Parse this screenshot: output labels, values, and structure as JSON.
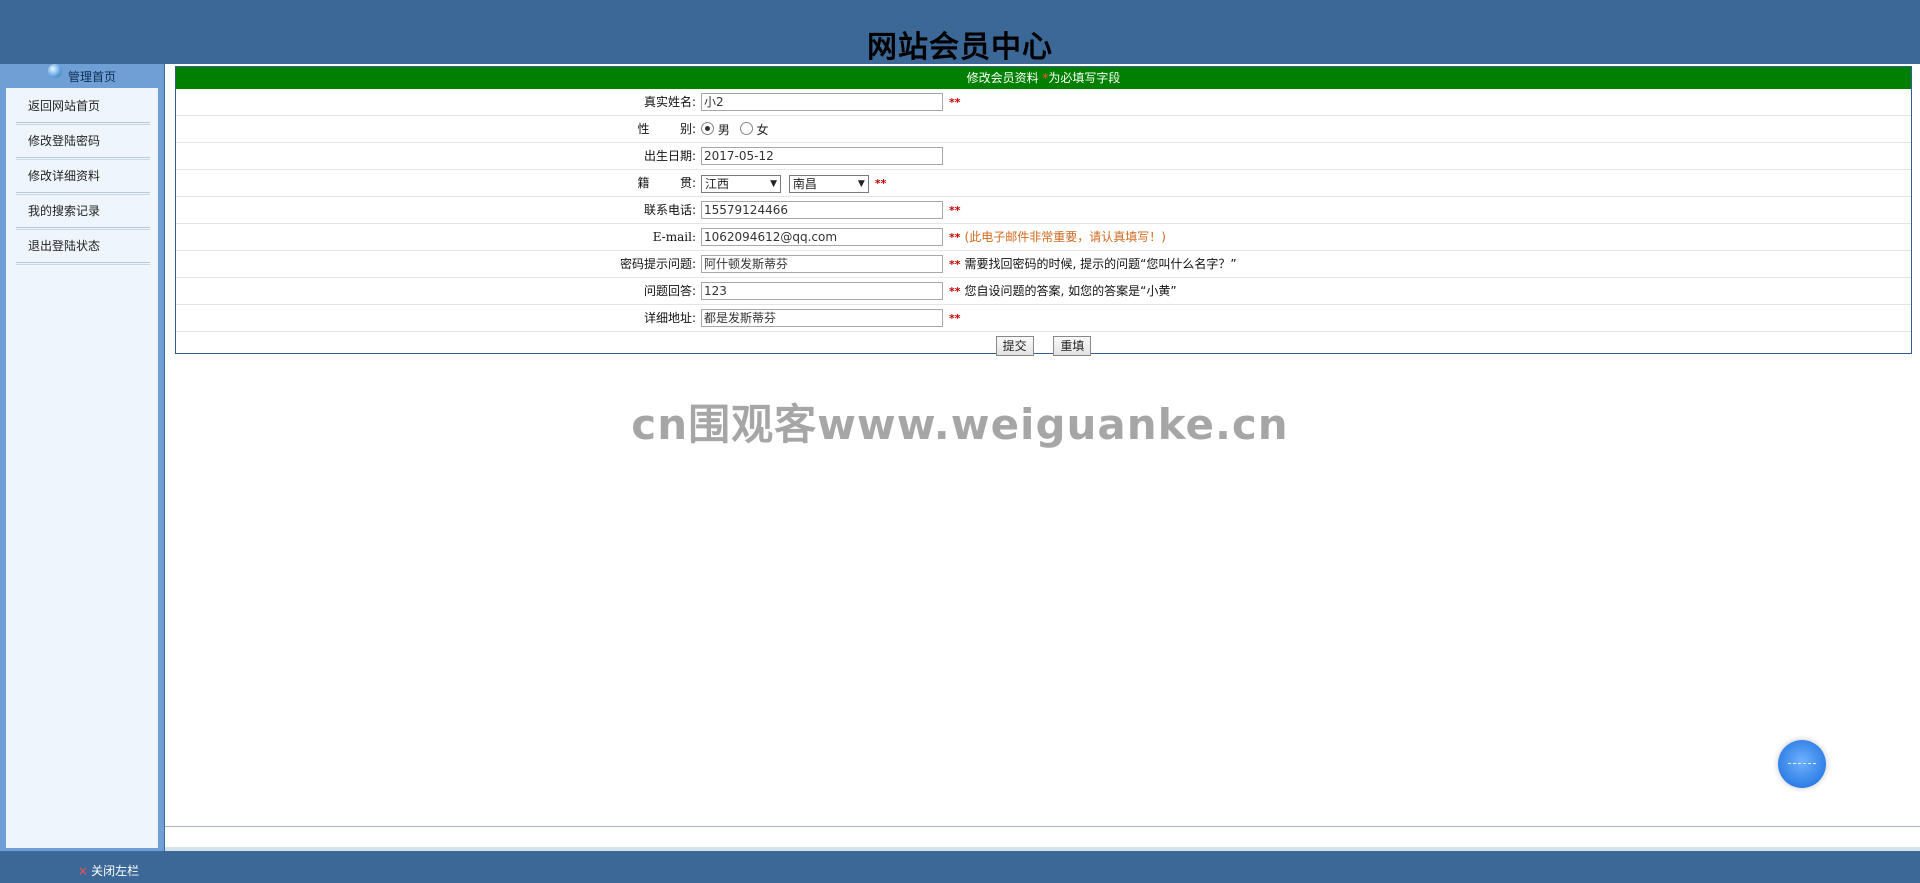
{
  "header": {
    "title": "网站会员中心"
  },
  "sidebar": {
    "head_label": "管理首页",
    "items": [
      {
        "label": "返回网站首页"
      },
      {
        "label": "修改登陆密码"
      },
      {
        "label": "修改详细资料"
      },
      {
        "label": "我的搜索记录"
      },
      {
        "label": "退出登陆状态"
      }
    ]
  },
  "form": {
    "header_title": "修改会员资料",
    "header_star": "*",
    "header_note": "为必填写字段",
    "required_mark": "**",
    "rows": {
      "real_name": {
        "label": "真实姓名:",
        "value": "小2"
      },
      "gender": {
        "label": "性        别:",
        "options": [
          "男",
          "女"
        ],
        "selected": "男"
      },
      "birthday": {
        "label": "出生日期:",
        "value": "2017-05-12"
      },
      "native_place": {
        "label": "籍        贯:",
        "province": "江西",
        "city": "南昌"
      },
      "phone": {
        "label": "联系电话:",
        "value": "15579124466"
      },
      "email": {
        "label": "E-mail:",
        "value": "1062094612@qq.com",
        "hint": "(此电子邮件非常重要，请认真填写！)"
      },
      "pw_question": {
        "label": "密码提示问题:",
        "value": "阿什顿发斯蒂芬",
        "hint": "需要找回密码的时候, 提示的问题“您叫什么名字？”"
      },
      "pw_answer": {
        "label": "问题回答:",
        "value": "123",
        "hint": "您自设问题的答案, 如您的答案是“小黄”"
      },
      "address": {
        "label": "详细地址:",
        "value": "都是发斯蒂芬"
      }
    },
    "buttons": {
      "submit": "提交",
      "reset": "重填"
    }
  },
  "watermark": "cn围观客www.weiguanke.cn",
  "footer": {
    "close_x": "×",
    "close_label": "关闭左栏"
  }
}
